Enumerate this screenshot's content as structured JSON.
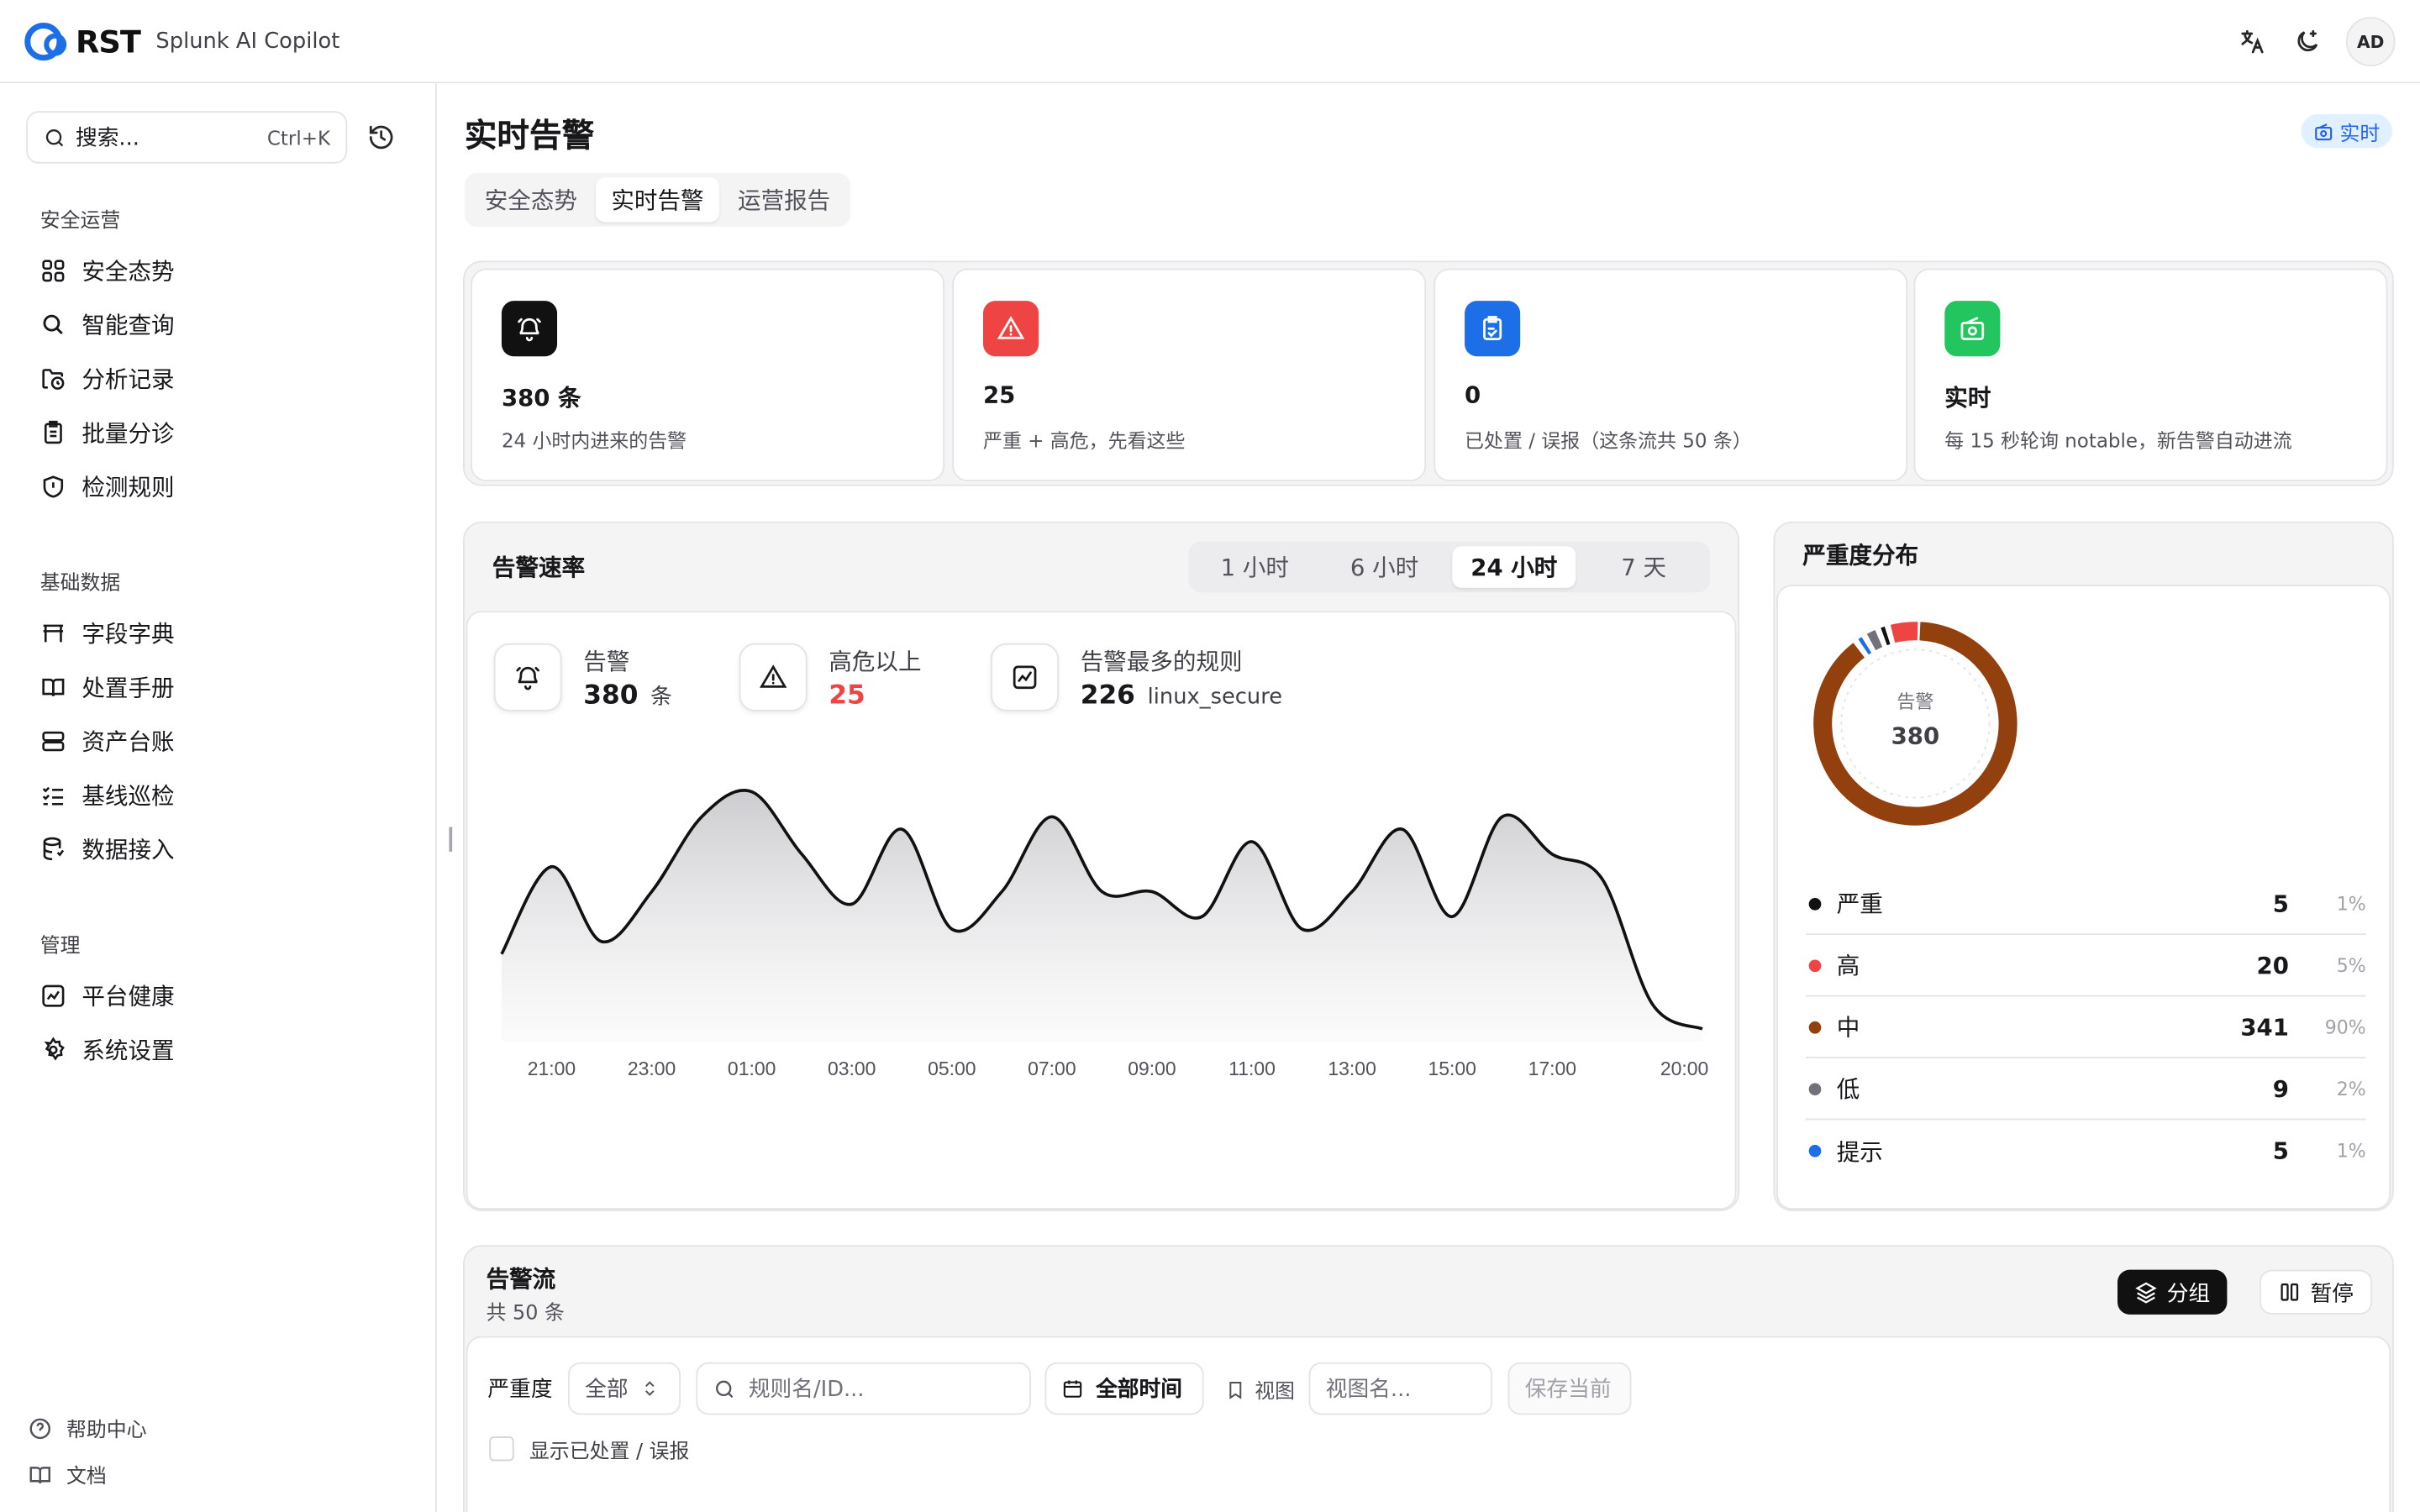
{
  "app": {
    "logo_text": "RST",
    "subtitle": "Splunk AI Copilot",
    "avatar": "AD"
  },
  "sidebar": {
    "search_placeholder": "搜索...",
    "search_shortcut": "Ctrl+K",
    "groups": [
      {
        "title": "安全运营",
        "items": [
          "安全态势",
          "智能查询",
          "分析记录",
          "批量分诊",
          "检测规则"
        ]
      },
      {
        "title": "基础数据",
        "items": [
          "字段字典",
          "处置手册",
          "资产台账",
          "基线巡检",
          "数据接入"
        ]
      },
      {
        "title": "管理",
        "items": [
          "平台健康",
          "系统设置"
        ]
      }
    ],
    "footer": [
      "帮助中心",
      "文档"
    ]
  },
  "page": {
    "title": "实时告警",
    "live_badge": "实时",
    "tabs": [
      "安全态势",
      "实时告警",
      "运营报告"
    ],
    "active_tab": 1
  },
  "stats": [
    {
      "value": "380 条",
      "desc": "24 小时内进来的告警",
      "color": "#111111",
      "icon": "bell-icon"
    },
    {
      "value": "25",
      "desc": "严重 + 高危，先看这些",
      "color": "#ef4444",
      "icon": "alert-triangle-icon"
    },
    {
      "value": "0",
      "desc": "已处置 / 误报（这条流共 50 条）",
      "color": "#1d6fe8",
      "icon": "clipboard-check-icon"
    },
    {
      "value": "实时",
      "desc": "每 15 秒轮询 notable，新告警自动进流",
      "color": "#22c55e",
      "icon": "radio-icon"
    }
  ],
  "rate_panel": {
    "title": "告警速率",
    "ranges": [
      "1 小时",
      "6 小时",
      "24 小时",
      "7 天"
    ],
    "active_range": 2,
    "metrics": [
      {
        "label": "告警",
        "value": "380",
        "unit": "条"
      },
      {
        "label": "高危以上",
        "value": "25",
        "unit": ""
      },
      {
        "label": "告警最多的规则",
        "value": "226",
        "unit": "linux_secure"
      }
    ]
  },
  "chart_data": {
    "type": "area",
    "title": "",
    "xlabel": "",
    "ylabel": "",
    "x_ticks": [
      "21:00",
      "23:00",
      "01:00",
      "03:00",
      "05:00",
      "07:00",
      "09:00",
      "11:00",
      "13:00",
      "15:00",
      "17:00",
      "20:00"
    ],
    "x": [
      "20:00",
      "21:00",
      "22:00",
      "23:00",
      "00:00",
      "01:00",
      "02:00",
      "03:00",
      "04:00",
      "05:00",
      "06:00",
      "07:00",
      "08:00",
      "09:00",
      "10:00",
      "11:00",
      "12:00",
      "13:00",
      "14:00",
      "15:00",
      "16:00",
      "17:00",
      "18:00",
      "19:00",
      "20:00"
    ],
    "values": [
      7,
      14,
      8,
      12,
      18,
      20,
      15,
      11,
      17,
      9,
      12,
      18,
      12,
      12,
      10,
      16,
      9,
      12,
      17,
      10,
      18,
      15,
      13,
      3,
      1
    ],
    "ylim": [
      0,
      22
    ],
    "grid": false,
    "color": "#111111"
  },
  "severity": {
    "title": "严重度分布",
    "center_label": "告警",
    "center_value": "380",
    "rows": [
      {
        "name": "严重",
        "count": 5,
        "pct": "1%",
        "color": "#111111"
      },
      {
        "name": "高",
        "count": 20,
        "pct": "5%",
        "color": "#ef4444"
      },
      {
        "name": "中",
        "count": 341,
        "pct": "90%",
        "color": "#92400e"
      },
      {
        "name": "低",
        "count": 9,
        "pct": "2%",
        "color": "#71717a"
      },
      {
        "name": "提示",
        "count": 5,
        "pct": "1%",
        "color": "#1d6fe8"
      }
    ]
  },
  "stream": {
    "title": "告警流",
    "subtitle": "共 50 条",
    "group_btn": "分组",
    "pause_btn": "暂停",
    "severity_label": "严重度",
    "severity_value": "全部",
    "rule_placeholder": "规则名/ID...",
    "time_btn": "全部时间",
    "view_label": "视图",
    "view_placeholder": "视图名...",
    "save_btn": "保存当前",
    "show_handled": "显示已处置 / 误报"
  }
}
